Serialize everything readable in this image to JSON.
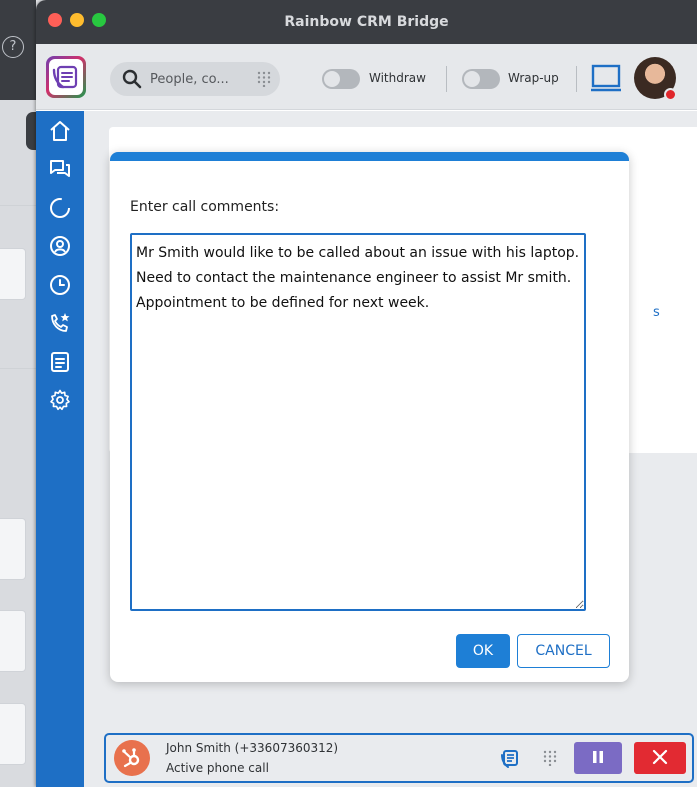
{
  "window": {
    "title": "Rainbow CRM Bridge"
  },
  "toolbar": {
    "search_placeholder": "People, co...",
    "withdraw_label": "Withdraw",
    "wrapup_label": "Wrap-up"
  },
  "sidebar": {
    "items": [
      {
        "icon": "home-icon"
      },
      {
        "icon": "conversations-icon"
      },
      {
        "icon": "bubbles-icon"
      },
      {
        "icon": "contacts-icon"
      },
      {
        "icon": "history-icon"
      },
      {
        "icon": "favorite-calls-icon"
      },
      {
        "icon": "notes-icon"
      },
      {
        "icon": "settings-icon"
      }
    ]
  },
  "dialog": {
    "title": "Enter call comments:",
    "comments": "Mr Smith would like to be called about an issue with his laptop.\nNeed to contact the maintenance engineer to assist Mr smith.\nAppointment to be defined for next week.",
    "ok_label": "OK",
    "cancel_label": "CANCEL"
  },
  "callbar": {
    "caller": "John Smith (+33607360312)",
    "status": "Active phone call"
  },
  "colors": {
    "sidebar": "#1e6fc5",
    "accent": "#1e7fd6",
    "titlebar": "#3a3d42",
    "hold": "#7b6bc4",
    "hangup": "#e22a32",
    "caller_badge": "#e8714d"
  }
}
